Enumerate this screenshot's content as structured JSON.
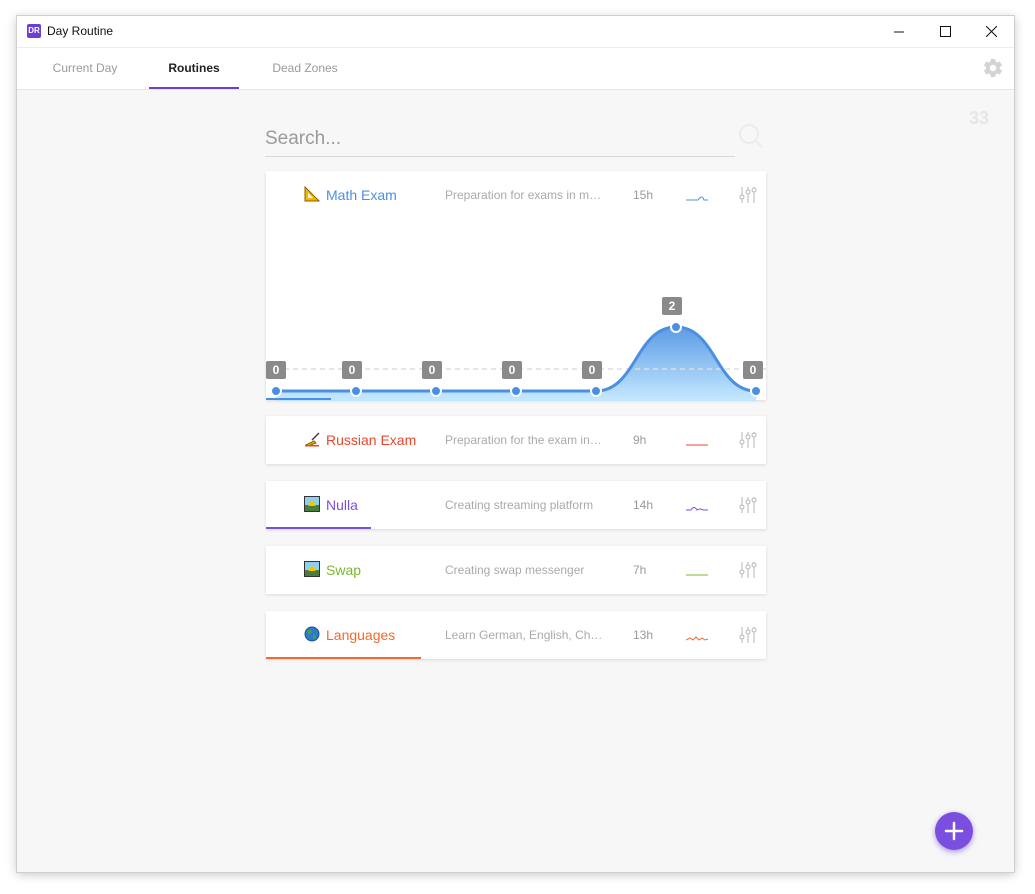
{
  "window": {
    "title": "Day Routine",
    "app_icon_text": "DR"
  },
  "tabs": [
    {
      "label": "Current Day",
      "active": false
    },
    {
      "label": "Routines",
      "active": true
    },
    {
      "label": "Dead Zones",
      "active": false
    }
  ],
  "counter": "33",
  "search": {
    "placeholder": "Search..."
  },
  "routines": [
    {
      "name": "Math Exam",
      "emoji": "triangular-ruler-icon",
      "description": "Preparation for exams in ma...",
      "hours": "15h",
      "color": "#4a90e2",
      "progress": 0.13
    },
    {
      "name": "Russian Exam",
      "emoji": "writing-hand-icon",
      "description": "Preparation for the exam in ...",
      "hours": "9h",
      "color": "#e8472e",
      "progress": 0
    },
    {
      "name": "Nulla",
      "emoji": "sunrise-image-icon",
      "description": "Creating streaming platform",
      "hours": "14h",
      "color": "#7a4fe0",
      "progress": 0.21
    },
    {
      "name": "Swap",
      "emoji": "sunrise-image-icon",
      "description": "Creating swap messenger",
      "hours": "7h",
      "color": "#7cb82f",
      "progress": 0
    },
    {
      "name": "Languages",
      "emoji": "globe-icon",
      "description": "Learn German, English, Chin...",
      "hours": "13h",
      "color": "#f26a2e",
      "progress": 0.31
    }
  ],
  "chart_data": {
    "type": "area",
    "series": [
      {
        "values": [
          0,
          0,
          0,
          0,
          0,
          2,
          0
        ]
      }
    ],
    "data_labels": [
      "0",
      "0",
      "0",
      "0",
      "0",
      "2",
      "0"
    ],
    "reference_line": 1,
    "color": "#4a90e2"
  },
  "fab": {
    "label": "+"
  }
}
